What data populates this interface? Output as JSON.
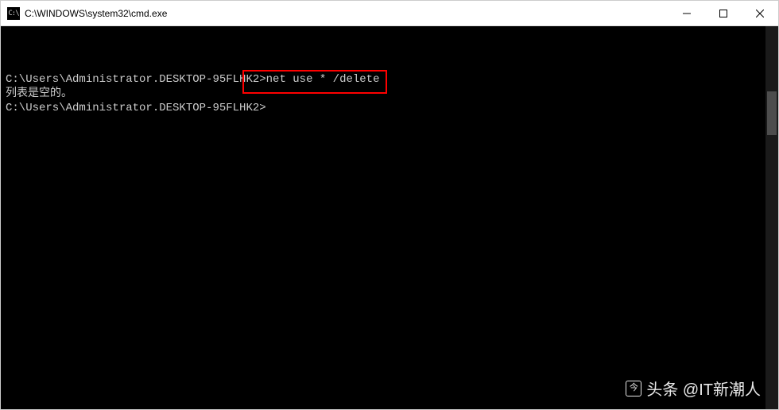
{
  "titlebar": {
    "icon_text": "C:\\",
    "title": "C:\\WINDOWS\\system32\\cmd.exe"
  },
  "terminal": {
    "line1_prompt": "C:\\Users\\Administrator.DESKTOP-95FLHK2>",
    "line1_command": "net use * /delete",
    "line2": "列表是空的。",
    "line3": "",
    "line4_prompt": "C:\\Users\\Administrator.DESKTOP-95FLHK2>"
  },
  "watermark": {
    "icon_glyph": "今",
    "text": "头条 @IT新潮人"
  }
}
